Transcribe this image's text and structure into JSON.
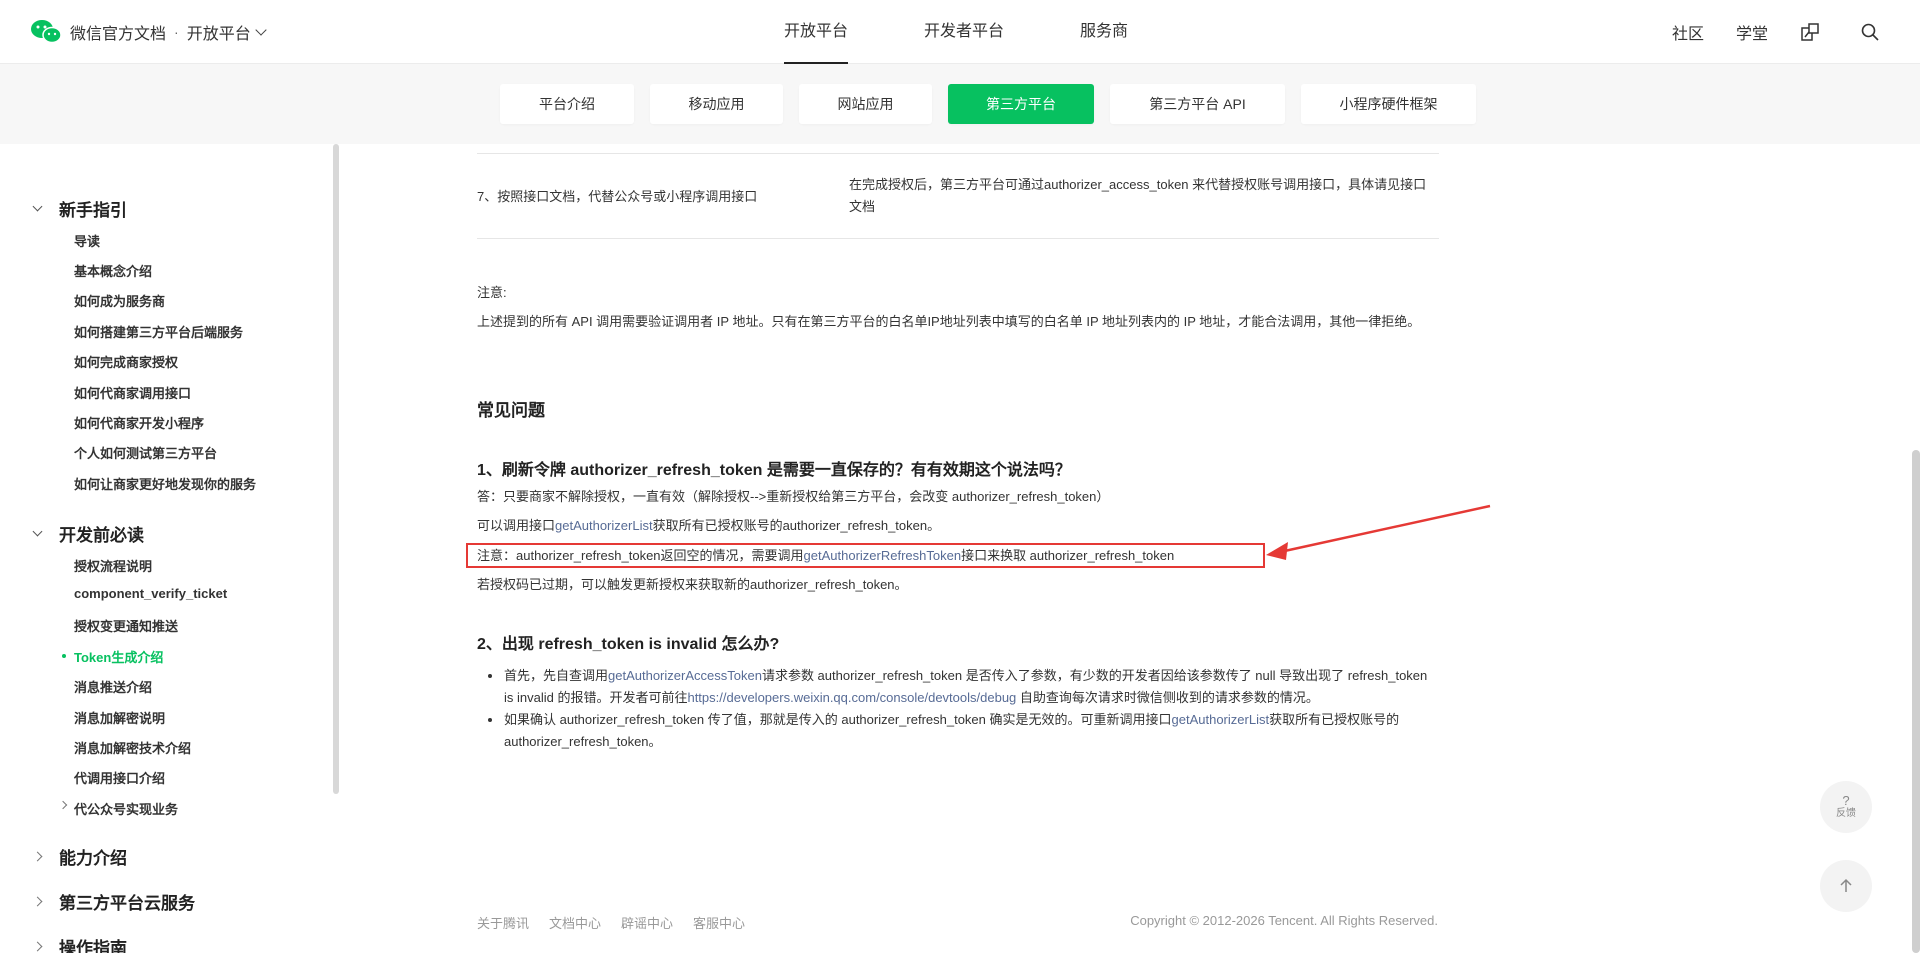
{
  "header": {
    "brand": "微信官方文档",
    "separator": "·",
    "platform": "开放平台",
    "nav": [
      {
        "label": "开放平台"
      },
      {
        "label": "开发者平台"
      },
      {
        "label": "服务商"
      }
    ],
    "right_links": {
      "community": "社区",
      "academy": "学堂"
    }
  },
  "subnav": {
    "tabs": [
      {
        "label": "平台介绍"
      },
      {
        "label": "移动应用"
      },
      {
        "label": "网站应用"
      },
      {
        "label": "第三方平台"
      },
      {
        "label": "第三方平台 API"
      },
      {
        "label": "小程序硬件框架"
      }
    ]
  },
  "sidebar": {
    "sections": [
      {
        "label": "新手指引"
      },
      {
        "label": "开发前必读"
      },
      {
        "label": "能力介绍"
      },
      {
        "label": "第三方平台云服务"
      },
      {
        "label": "操作指南"
      }
    ],
    "items_guide": [
      "导读",
      "基本概念介绍",
      "如何成为服务商",
      "如何搭建第三方平台后端服务",
      "如何完成商家授权",
      "如何代商家调用接口",
      "如何代商家开发小程序",
      "个人如何测试第三方平台",
      "如何让商家更好地发现你的服务"
    ],
    "items_before": [
      "授权流程说明",
      "component_verify_ticket",
      "授权变更通知推送",
      "Token生成介绍",
      "消息推送介绍",
      "消息加解密说明",
      "消息加解密技术介绍",
      "代调用接口介绍",
      "代公众号实现业务"
    ]
  },
  "content": {
    "table_step": "7、按照接口文档，代替公众号或小程序调用接口",
    "table_desc": "在完成授权后，第三方平台可通过authorizer_access_token 来代替授权账号调用接口，具体请见接口文档",
    "note_label": "注意:",
    "note_text": "上述提到的所有 API 调用需要验证调用者 IP 地址。只有在第三方平台的白名单IP地址列表中填写的白名单 IP 地址列表内的 IP 地址，才能合法调用，其他一律拒绝。",
    "faq_title": "常见问题",
    "q1": "1、刷新令牌 authorizer_refresh_token 是需要一直保存的？有有效期这个说法吗？",
    "a1_line1": "答：只要商家不解除授权，一直有效（解除授权-->重新授权给第三方平台，会改变 authorizer_refresh_token）",
    "a1_line2_pre": "可以调用接口",
    "a1_line2_link": "getAuthorizerList",
    "a1_line2_post": "获取所有已授权账号的authorizer_refresh_token。",
    "a1_line3_pre": "注意：authorizer_refresh_token返回空的情况，需要调用",
    "a1_line3_link": "getAuthorizerRefreshToken",
    "a1_line3_post": "接口来换取 authorizer_refresh_token",
    "a1_line4": "若授权码已过期，可以触发更新授权来获取新的authorizer_refresh_token。",
    "q2": "2、出现 refresh_token is invalid 怎么办?",
    "b1_pre": "首先，先自查调用",
    "b1_link": "getAuthorizerAccessToken",
    "b1_mid": "请求参数 authorizer_refresh_token 是否传入了参数，有少数的开发者因给该参数传了 null 导致出现了 refresh_token is invalid 的报错。开发者可前往",
    "b1_url": "https://developers.weixin.qq.com/console/devtools/debug",
    "b1_post": " 自助查询每次请求时微信侧收到的请求参数的情况。",
    "b2_pre": "如果确认 authorizer_refresh_token 传了值，那就是传入的 authorizer_refresh_token 确实是无效的。可重新调用接口",
    "b2_link": "getAuthorizerList",
    "b2_post": "获取所有已授权账号的 authorizer_refresh_token。"
  },
  "footer": {
    "links": [
      "关于腾讯",
      "文档中心",
      "辟谣中心",
      "客服中心"
    ],
    "copyright": "Copyright © 2012-2026 Tencent. All Rights Reserved."
  },
  "float": {
    "feedback_q": "?",
    "feedback_label": "反馈"
  },
  "colors": {
    "accent": "#07c160",
    "link": "#576b95",
    "highlight": "#e53935"
  }
}
